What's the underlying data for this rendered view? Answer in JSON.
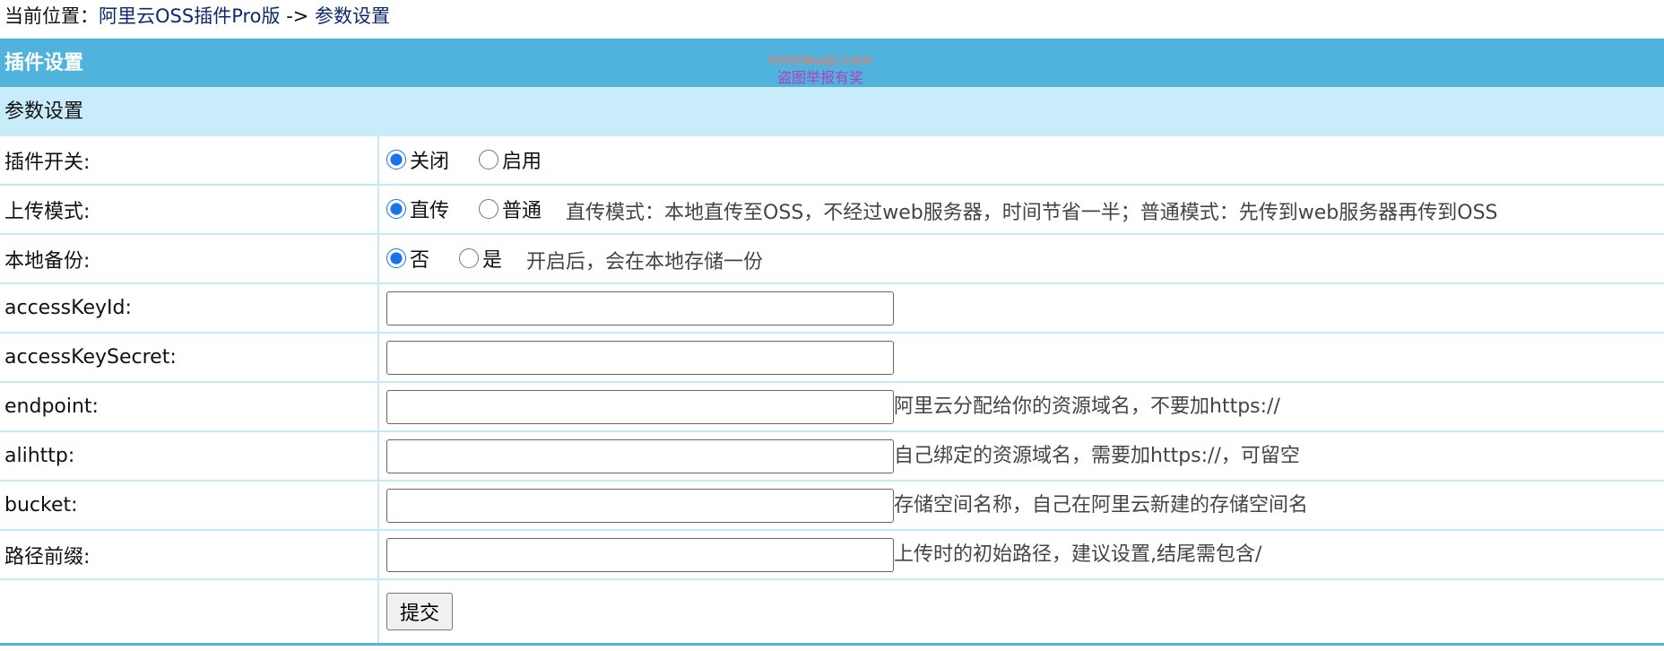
{
  "breadcrumb": {
    "prefix": "当前位置：",
    "plugin_link": "阿里云OSS插件Pro版",
    "separator": " -> ",
    "page_link": "参数设置"
  },
  "header": {
    "title": "插件设置",
    "watermark_line1": "mimiwuqi.com",
    "watermark_line2": "盗图举报有奖"
  },
  "subheader": {
    "title": "参数设置"
  },
  "rows": {
    "plugin_switch": {
      "label": "插件开关:",
      "options": [
        "关闭",
        "启用"
      ],
      "selected": "关闭"
    },
    "upload_mode": {
      "label": "上传模式:",
      "options": [
        "直传",
        "普通"
      ],
      "selected": "直传",
      "hint": "直传模式：本地直传至OSS，不经过web服务器，时间节省一半；普通模式：先传到web服务器再传到OSS"
    },
    "local_backup": {
      "label": "本地备份:",
      "options": [
        "否",
        "是"
      ],
      "selected": "否",
      "hint": "开启后，会在本地存储一份"
    },
    "access_key_id": {
      "label": "accessKeyId:",
      "value": ""
    },
    "access_key_secret": {
      "label": "accessKeySecret:",
      "value": ""
    },
    "endpoint": {
      "label": "endpoint:",
      "value": "",
      "hint": "阿里云分配给你的资源域名，不要加https://"
    },
    "alihttp": {
      "label": "alihttp:",
      "value": "",
      "hint": "自己绑定的资源域名，需要加https://，可留空"
    },
    "bucket": {
      "label": "bucket:",
      "value": "",
      "hint": "存储空间名称，自己在阿里云新建的存储空间名"
    },
    "path_prefix": {
      "label": "路径前缀:",
      "value": "",
      "hint": "上传时的初始路径，建议设置,结尾需包含/"
    }
  },
  "submit_label": "提交",
  "colors": {
    "header_bg": "#4fb3de",
    "subheader_bg": "#c9ecfa",
    "link": "#0b2a6e"
  }
}
